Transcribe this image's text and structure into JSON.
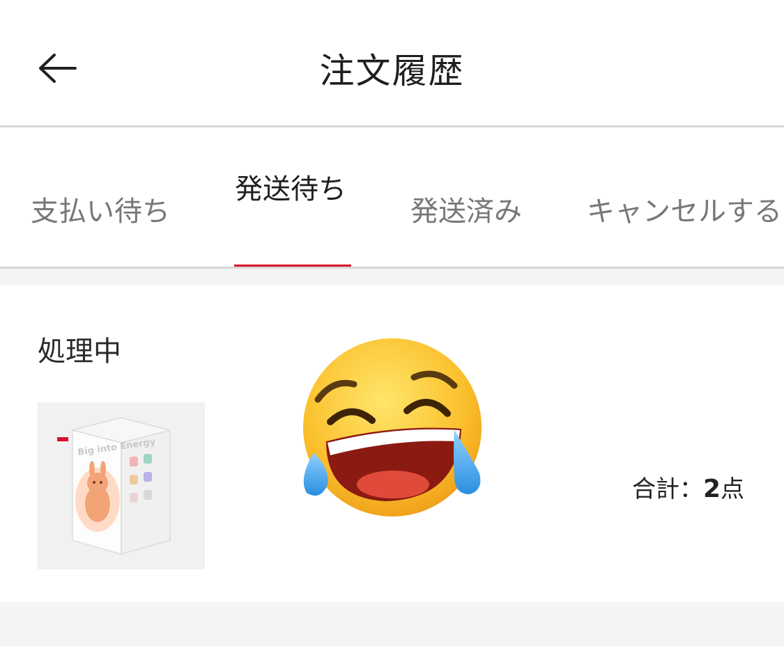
{
  "header": {
    "title": "注文履歴"
  },
  "tabs": [
    {
      "label": "支払い待ち",
      "active": false
    },
    {
      "label": "発送待ち",
      "active": true
    },
    {
      "label": "発送済み",
      "active": false
    },
    {
      "label": "キャンセルする",
      "active": false
    }
  ],
  "order": {
    "status": "処理中",
    "product_box_text": "Big into Energy",
    "total_prefix": "合計：",
    "total_count": "2",
    "total_suffix": "点"
  },
  "colors": {
    "accent": "#d8102c",
    "background": "#f4f4f4"
  },
  "icons": [
    "back-arrow-icon",
    "laughing-crying-emoji"
  ]
}
